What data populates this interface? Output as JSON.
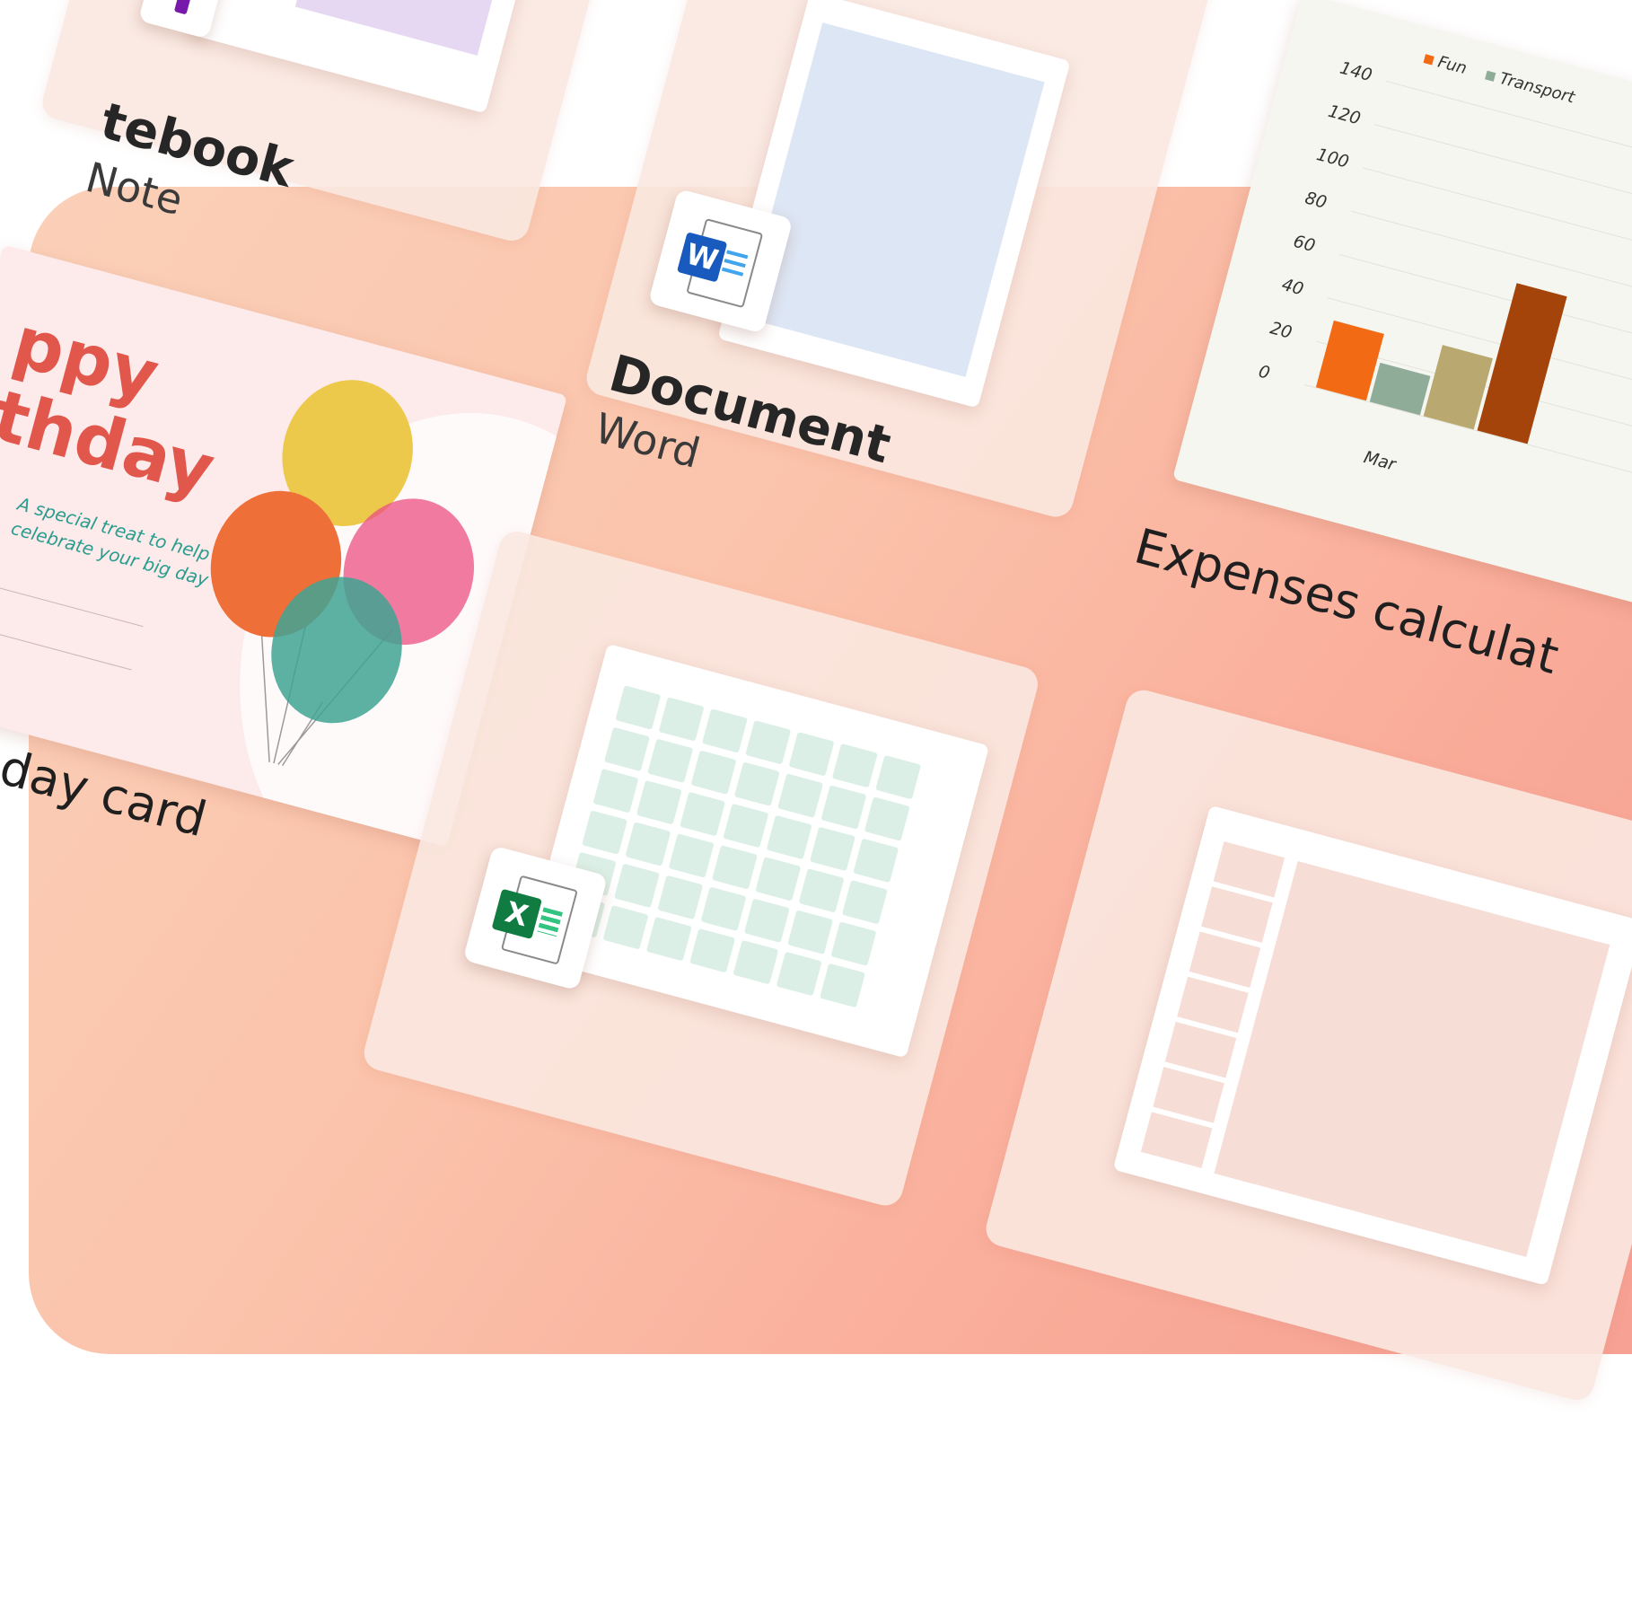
{
  "cards": {
    "notebook": {
      "title": "tebook",
      "app": "Note"
    },
    "document": {
      "title": "Document",
      "app": "Word",
      "icon": "word-icon",
      "icon_letter": "W"
    },
    "expenses": {
      "title": "Expenses calculat",
      "legend": [
        "Fun",
        "Transport"
      ],
      "y_ticks": [
        "140",
        "120",
        "100",
        "80",
        "60",
        "40",
        "20",
        "0"
      ],
      "x_label": "Mar"
    },
    "birthday": {
      "headline_1": "ppy",
      "headline_2": "thday",
      "tagline_1": "A special treat to help",
      "tagline_2": "celebrate your big day",
      "title": "rthday card"
    },
    "spreadsheet": {
      "icon": "excel-icon",
      "icon_letter": "X"
    }
  },
  "colors": {
    "word_blue": "#185abd",
    "excel_green": "#107c41",
    "onenote_purple": "#7719aa",
    "birthday_red": "#e2574c",
    "teal_text": "#2a9d8f"
  },
  "chart_data": {
    "type": "bar",
    "categories": [
      "Mar"
    ],
    "series": [
      {
        "name": "Fun",
        "values": [
          31
        ]
      },
      {
        "name": "Transport",
        "values": [
          18
        ]
      },
      {
        "values": [
          33
        ]
      },
      {
        "values": [
          68
        ]
      }
    ],
    "ylim": [
      0,
      140
    ],
    "yticks": [
      0,
      20,
      40,
      60,
      80,
      100,
      120,
      140
    ]
  }
}
